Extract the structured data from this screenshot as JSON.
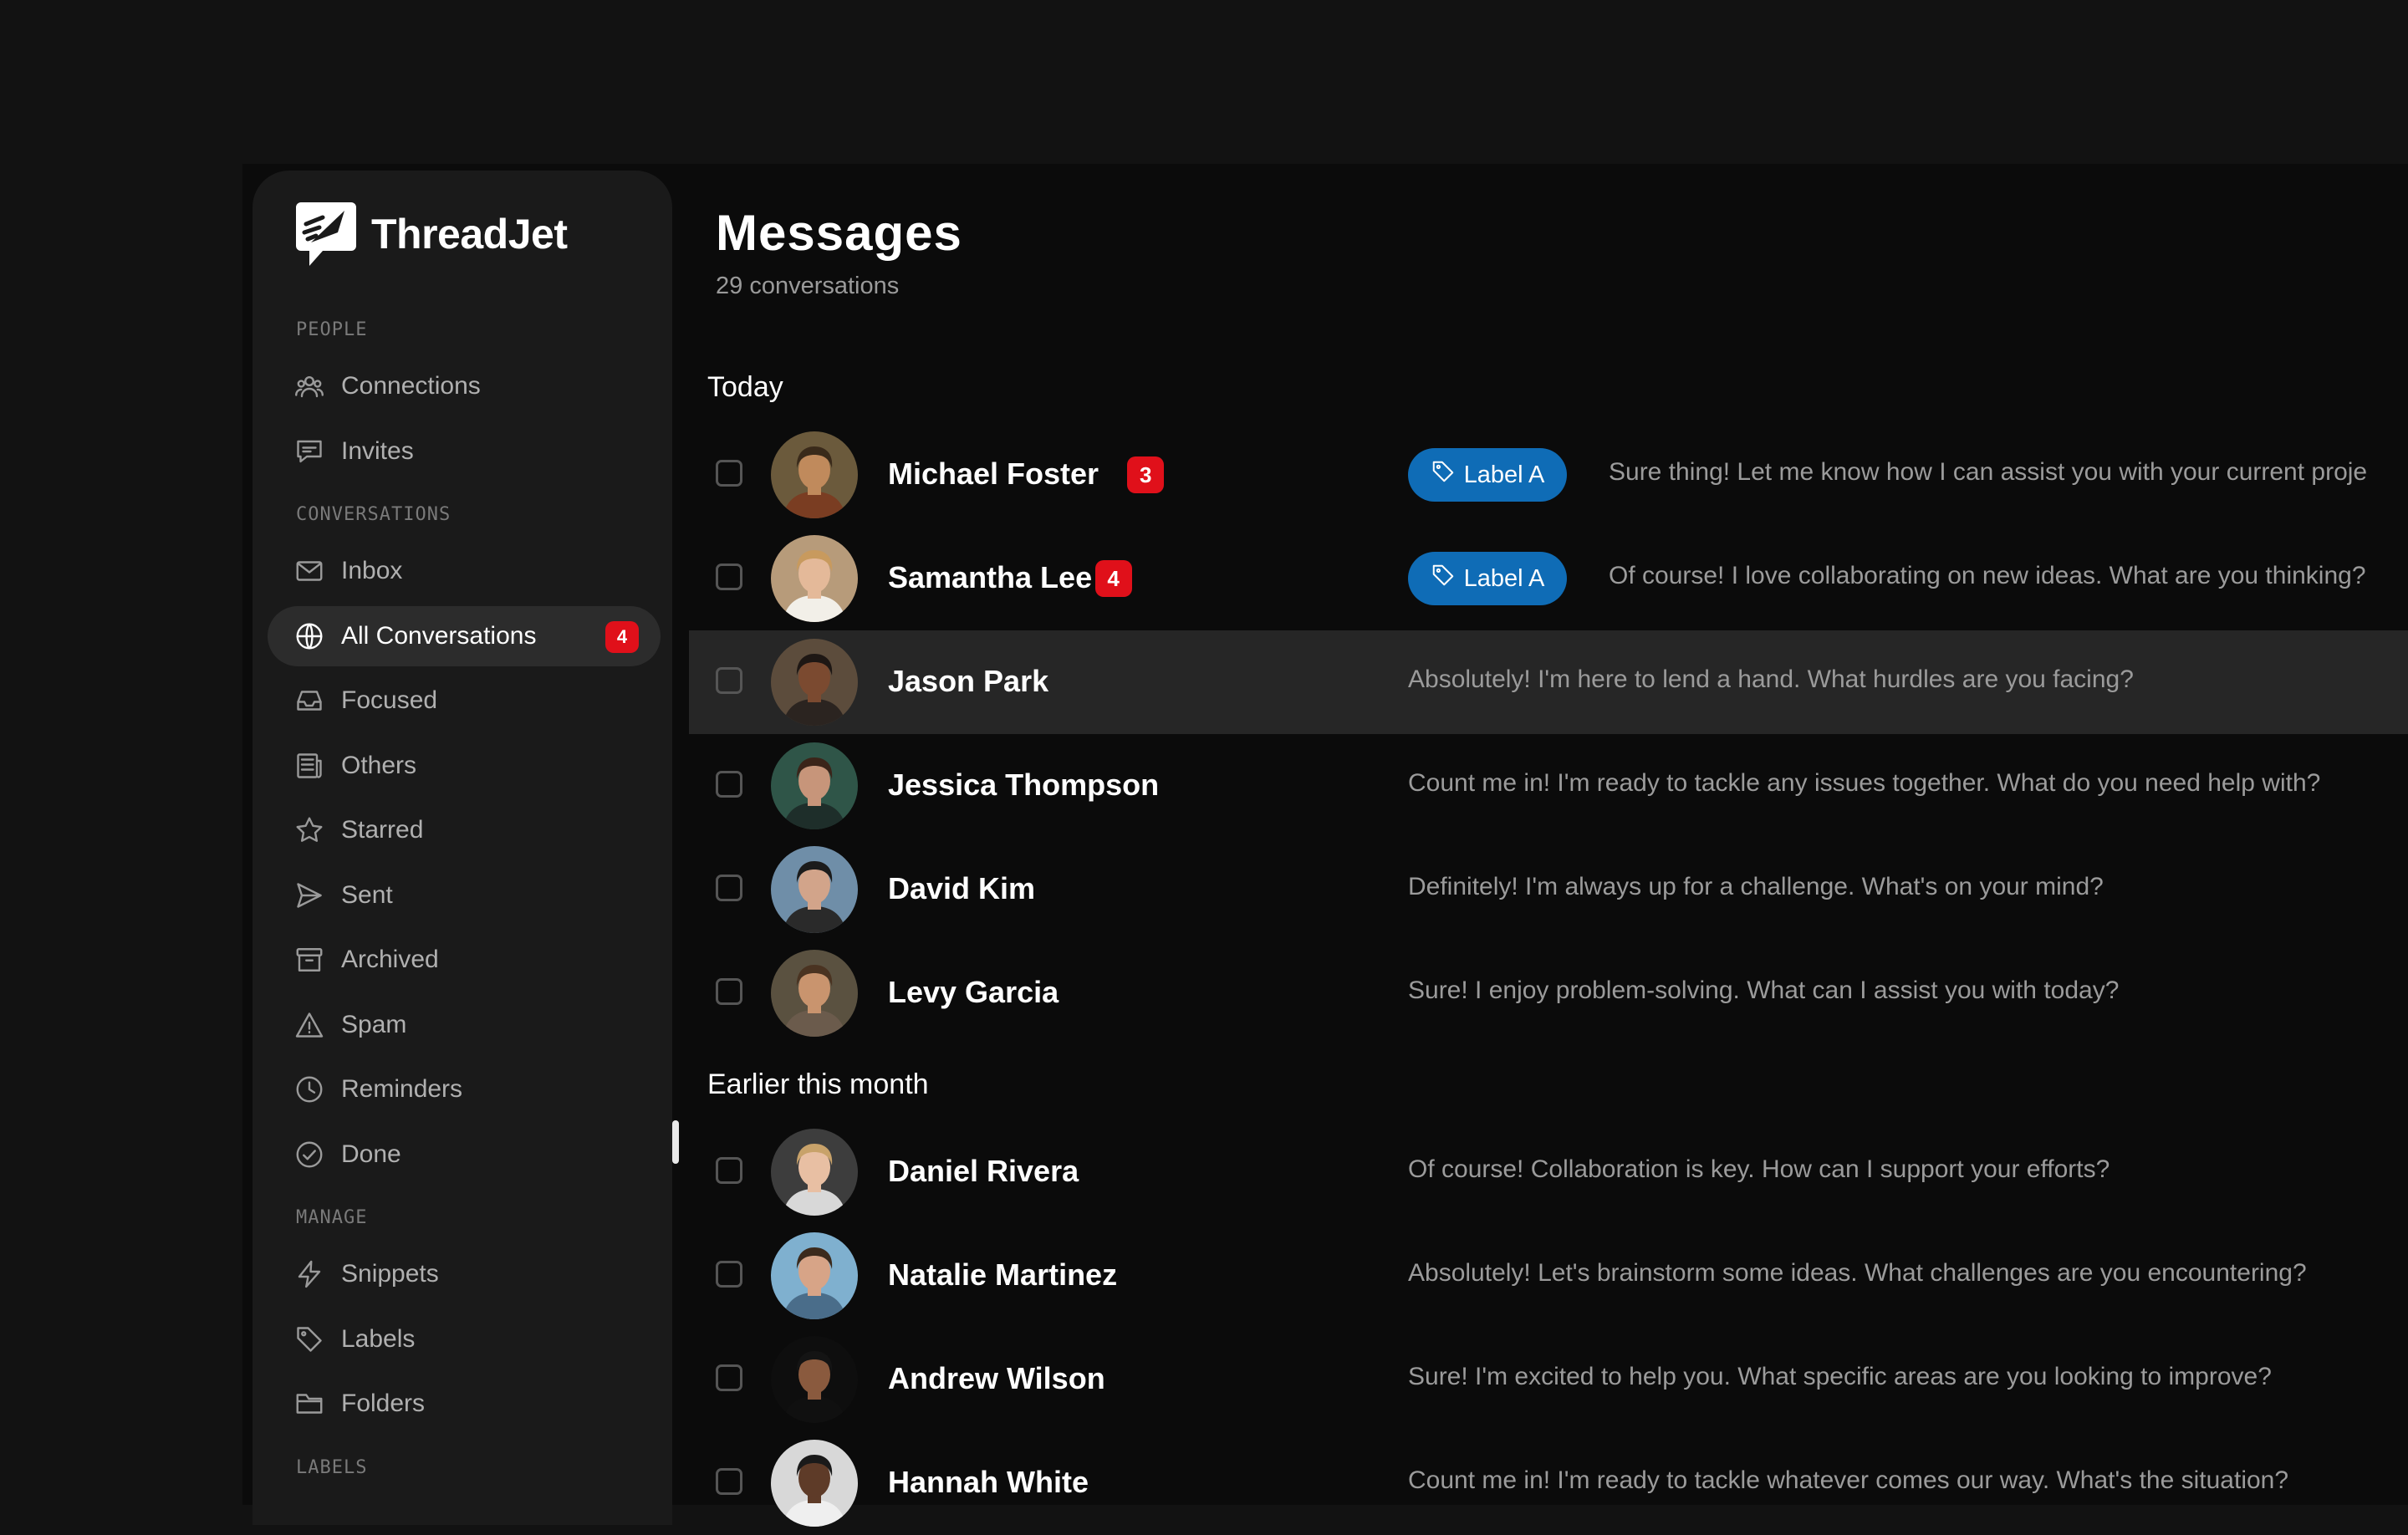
{
  "app": {
    "name": "ThreadJet"
  },
  "sidebar": {
    "sections": [
      {
        "label": "PEOPLE",
        "items": [
          {
            "label": "Connections",
            "icon": "users-icon"
          },
          {
            "label": "Invites",
            "icon": "chat-bubble-icon"
          }
        ]
      },
      {
        "label": "CONVERSATIONS",
        "items": [
          {
            "label": "Inbox",
            "icon": "mail-icon"
          },
          {
            "label": "All Conversations",
            "icon": "globe-icon",
            "badge": "4",
            "active": true
          },
          {
            "label": "Focused",
            "icon": "inbox-tray-icon"
          },
          {
            "label": "Others",
            "icon": "newspaper-icon"
          },
          {
            "label": "Starred",
            "icon": "star-icon"
          },
          {
            "label": "Sent",
            "icon": "send-icon"
          },
          {
            "label": "Archived",
            "icon": "archive-icon"
          },
          {
            "label": "Spam",
            "icon": "warning-icon"
          },
          {
            "label": "Reminders",
            "icon": "clock-icon"
          },
          {
            "label": "Done",
            "icon": "check-circle-icon"
          }
        ]
      },
      {
        "label": "MANAGE",
        "items": [
          {
            "label": "Snippets",
            "icon": "lightning-icon"
          },
          {
            "label": "Labels",
            "icon": "tag-icon"
          },
          {
            "label": "Folders",
            "icon": "folder-icon"
          }
        ]
      },
      {
        "label": "LABELS",
        "items": []
      }
    ]
  },
  "main": {
    "title": "Messages",
    "subtitle": "29 conversations",
    "groups": [
      {
        "label": "Today",
        "rows": [
          {
            "name": "Michael Foster",
            "badge": "3",
            "label": "Label A",
            "preview": "Sure thing! Let me know how I can assist you with your current proje"
          },
          {
            "name": "Samantha Lee",
            "badge": "4",
            "label": "Label A",
            "preview": "Of course! I love collaborating on new ideas. What are you thinking?"
          },
          {
            "name": "Jason Park",
            "preview": "Absolutely! I'm here to lend a hand. What hurdles are you facing?",
            "hover": true
          },
          {
            "name": "Jessica Thompson",
            "preview": "Count me in! I'm ready to tackle any issues together. What do you need help with?"
          },
          {
            "name": "David Kim",
            "preview": "Definitely! I'm always up for a challenge. What's on your mind?"
          },
          {
            "name": "Levy Garcia",
            "preview": "Sure! I enjoy problem-solving. What can I assist you with today?"
          }
        ]
      },
      {
        "label": "Earlier this month",
        "rows": [
          {
            "name": "Daniel Rivera",
            "preview": "Of course! Collaboration is key. How can I support your efforts?"
          },
          {
            "name": "Natalie Martinez",
            "preview": "Absolutely! Let's brainstorm some ideas. What challenges are you encountering?"
          },
          {
            "name": "Andrew Wilson",
            "preview": "Sure! I'm excited to help you. What specific areas are you looking to improve?"
          },
          {
            "name": "Hannah White",
            "preview": "Count me in! I'm ready to tackle whatever comes our way. What's the situation?"
          }
        ]
      }
    ]
  },
  "colors": {
    "accent_blue": "#0f6cb6",
    "badge_red": "#e0101a",
    "background": "#0b0b0b",
    "sidebar": "#1a1a1a"
  }
}
